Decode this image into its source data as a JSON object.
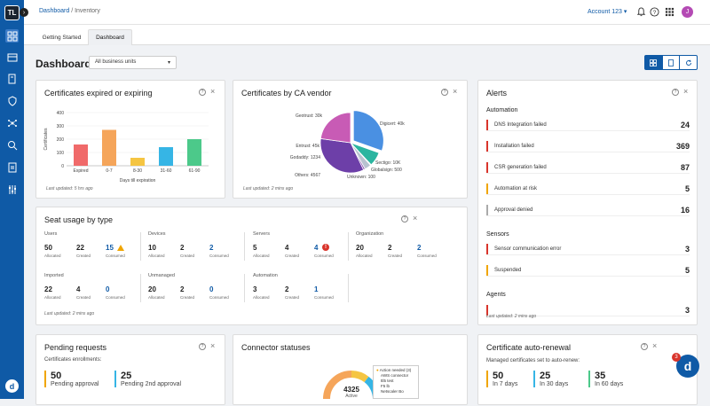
{
  "logo": "TL",
  "breadcrumb": {
    "parent": "Dashboard",
    "current": "Inventory"
  },
  "account": "Account 123",
  "avatar": "J",
  "sidebar_bottom": "d",
  "tabs": [
    "Getting Started",
    "Dashboard"
  ],
  "page_title": "Dashboard",
  "business_units": "All business units",
  "cert_exp": {
    "title": "Certificates expired or expiring",
    "updated": "Last updated: 5 hrs ago",
    "chart_data": {
      "type": "bar",
      "categories": [
        "Expired",
        "0-7",
        "8-30",
        "31-60",
        "61-90"
      ],
      "values": [
        160,
        270,
        60,
        140,
        200
      ],
      "colors": [
        "#f06a6a",
        "#f5a55a",
        "#f5c542",
        "#36b5e5",
        "#4cc98a"
      ],
      "xlabel": "Days till expiration",
      "ylabel": "Certificates",
      "ylim": [
        0,
        400
      ],
      "yticks": [
        0,
        100,
        200,
        300,
        400
      ]
    }
  },
  "ca_vendor": {
    "title": "Certificates by CA vendor",
    "updated": "Last updated: 2 mins ago",
    "chart_data": {
      "type": "pie",
      "labels": [
        "Digicert: 40k",
        "Sectigo: 10K",
        "Globalsign: 500",
        "Unknown: 100",
        "Others: 4567",
        "Godaddy: 1234",
        "Entrust: 45k",
        "Geotrust: 30k"
      ],
      "values": [
        40000,
        10000,
        500,
        100,
        4567,
        1234,
        45000,
        30000
      ],
      "colors": [
        "#4a90e2",
        "#2bb5a0",
        "#1e7e7e",
        "#9fd4c6",
        "#b8c2d0",
        "#8a4fb0",
        "#6d3fa8",
        "#c85bb5"
      ]
    }
  },
  "seat": {
    "title": "Seat usage by type",
    "updated": "Last updated: 2 mins ago",
    "sub": {
      "allocated": "Allocated",
      "created": "Created",
      "consumed": "Consumed"
    },
    "groups": [
      {
        "name": "Users",
        "a": "50",
        "c": "22",
        "u": "15"
      },
      {
        "name": "Devices",
        "a": "10",
        "c": "2",
        "u": "2"
      },
      {
        "name": "Servers",
        "a": "5",
        "c": "4",
        "u": "4"
      },
      {
        "name": "Organization",
        "a": "20",
        "c": "2",
        "u": "2"
      },
      {
        "name": "Imported",
        "a": "22",
        "c": "4",
        "u": "0"
      },
      {
        "name": "Unmanaged",
        "a": "20",
        "c": "2",
        "u": "0"
      },
      {
        "name": "Automation",
        "a": "3",
        "c": "2",
        "u": "1"
      }
    ]
  },
  "alerts": {
    "title": "Alerts",
    "updated": "Last updated: 2 mins ago",
    "automation": "Automation",
    "sensors": "Sensors",
    "agents": "Agents",
    "rows": [
      {
        "label": "DNS Integration failed",
        "value": "24",
        "color": "#d9342b"
      },
      {
        "label": "Installation failed",
        "value": "369",
        "color": "#d9342b"
      },
      {
        "label": "CSR generation failed",
        "value": "87",
        "color": "#d9342b"
      },
      {
        "label": "Automation at risk",
        "value": "5",
        "color": "#f0a500"
      },
      {
        "label": "Approval denied",
        "value": "16",
        "color": "#aaaaaa"
      },
      {
        "label": "Sensor communication error",
        "value": "3",
        "color": "#d9342b"
      },
      {
        "label": "Suspended",
        "value": "5",
        "color": "#f0a500"
      },
      {
        "label": "",
        "value": "3",
        "color": "#d9342b"
      }
    ]
  },
  "pending": {
    "title": "Pending requests",
    "sub": "Certificates enrollments:",
    "items": [
      {
        "value": "50",
        "label": "Pending approval",
        "color": "#f0a500"
      },
      {
        "value": "25",
        "label": "Pending 2nd approval",
        "color": "#36b5e5"
      }
    ]
  },
  "connector": {
    "title": "Connector statuses",
    "center_value": "4325",
    "center_label": "Active",
    "popup": {
      "header": "Action needed",
      "count": "(3)",
      "items": [
        "AWS connector",
        "ttl5 test",
        "F5 lb",
        "Netscaler Bo"
      ]
    }
  },
  "renewal": {
    "title": "Certificate auto-renewal",
    "sub": "Managed certificates set to auto-renew:",
    "items": [
      {
        "value": "50",
        "label": "In 7 days",
        "color": "#f0a500"
      },
      {
        "value": "25",
        "label": "In 30 days",
        "color": "#36b5e5"
      },
      {
        "value": "35",
        "label": "In 60 days",
        "color": "#4cc98a"
      }
    ]
  },
  "chat": {
    "badge": "3",
    "letter": "d"
  }
}
